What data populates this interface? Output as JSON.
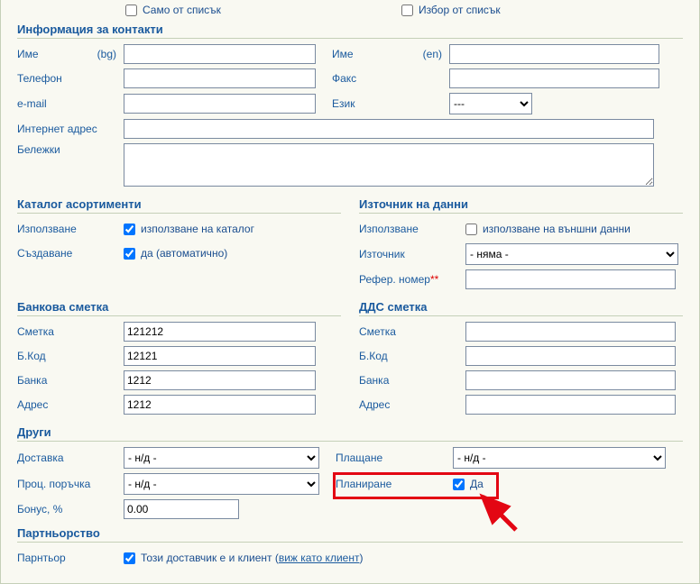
{
  "top": {
    "only_list_label": "Само от списък",
    "select_list_label": "Избор от списък"
  },
  "contact": {
    "header": "Информация за контакти",
    "name_label": "Име",
    "bg_tag": "(bg)",
    "en_tag": "(en)",
    "phone_label": "Телефон",
    "fax_label": "Факс",
    "email_label": "e-mail",
    "lang_label": "Език",
    "lang_value": "---",
    "url_label": "Интернет адрес",
    "notes_label": "Бележки"
  },
  "catalog": {
    "header": "Каталог асортименти",
    "use_label": "Използване",
    "use_check_label": "използване на каталог",
    "create_label": "Създаване",
    "create_check_label": "да (автоматично)"
  },
  "datasource": {
    "header": "Източник на данни",
    "use_label": "Използване",
    "use_check_label": "използване на външни данни",
    "source_label": "Източник",
    "source_value": "- няма -",
    "ref_label": "Рефер. номер",
    "ref_req": "**"
  },
  "bank": {
    "header": "Банкова сметка",
    "account_label": "Сметка",
    "account_value": "121212",
    "code_label": "Б.Код",
    "code_value": "12121",
    "bank_label": "Банка",
    "bank_value": "1212",
    "address_label": "Адрес",
    "address_value": "1212"
  },
  "vat": {
    "header": "ДДС сметка",
    "account_label": "Сметка",
    "code_label": "Б.Код",
    "bank_label": "Банка",
    "address_label": "Адрес"
  },
  "other": {
    "header": "Други",
    "delivery_label": "Доставка",
    "delivery_value": "- н/д -",
    "payment_label": "Плащане",
    "payment_value": "- н/д -",
    "proc_label": "Проц. поръчка",
    "proc_value": "- н/д -",
    "plan_label": "Планиране",
    "plan_check_label": "Да",
    "bonus_label": "Бонус, %",
    "bonus_value": "0.00"
  },
  "partner": {
    "header": "Партньорство",
    "label": "Парнтьор",
    "check_label": "Този доставчик е и клиент (",
    "link": "виж като клиент",
    "close": ")"
  }
}
